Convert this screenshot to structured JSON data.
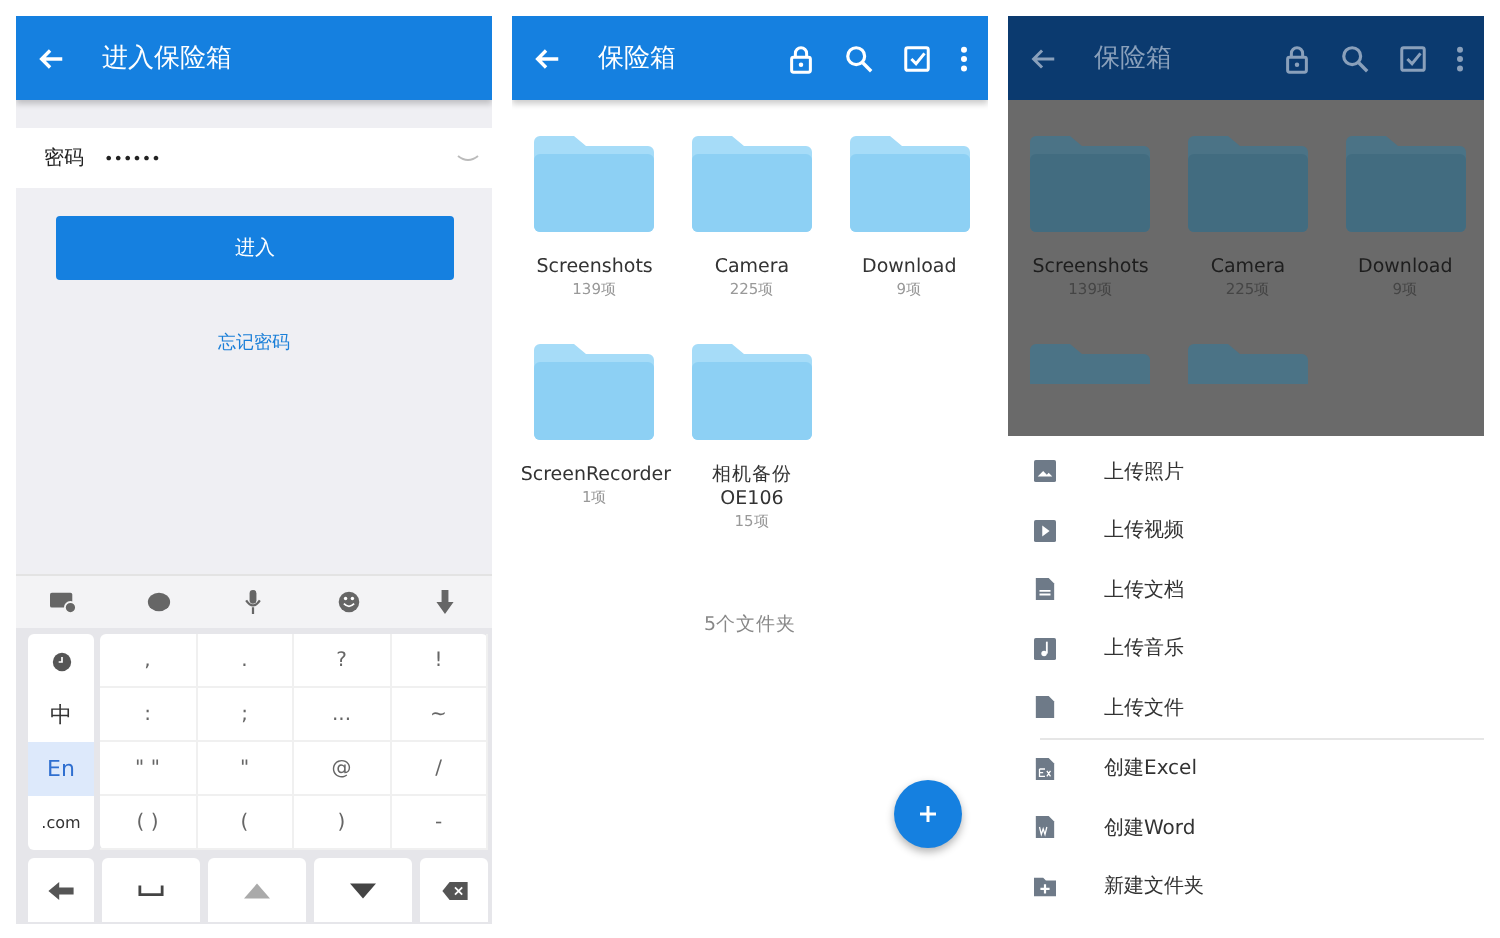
{
  "unlock_screen": {
    "title": "进入保险箱",
    "password": {
      "label": "密码",
      "value": "••••••"
    },
    "enter_button": "进入",
    "forgot_link": "忘记密码",
    "keyboard": {
      "side_keys": [
        {
          "kind": "clock",
          "selected": false
        },
        {
          "kind": "text",
          "label": "中",
          "selected": false
        },
        {
          "kind": "text",
          "label": "En",
          "selected": true
        },
        {
          "kind": "text",
          "label": ".com",
          "selected": false
        }
      ],
      "symbol_keys": [
        ",",
        ".",
        "?",
        "!",
        ":",
        ";",
        "...",
        "~",
        "\" \"",
        "\"",
        "@",
        "/",
        "( )",
        "(",
        ")",
        "-"
      ]
    }
  },
  "vault": {
    "title": "保险箱",
    "folders": [
      {
        "name": "Screenshots",
        "count": "139项"
      },
      {
        "name": "Camera",
        "count": "225项"
      },
      {
        "name": "Download",
        "count": "9项"
      },
      {
        "name": "ScreenRecorder",
        "count": "1项"
      },
      {
        "name": "相机备份 OE106",
        "count": "15项"
      }
    ],
    "summary": "5个文件夹"
  },
  "vault_with_menu": {
    "title": "保险箱",
    "folders": [
      {
        "name": "Screenshots",
        "count": "139项"
      },
      {
        "name": "Camera",
        "count": "225项"
      },
      {
        "name": "Download",
        "count": "9项"
      }
    ],
    "upload_items": [
      {
        "kind": "photo",
        "label": "上传照片"
      },
      {
        "kind": "video",
        "label": "上传视频"
      },
      {
        "kind": "document",
        "label": "上传文档"
      },
      {
        "kind": "music",
        "label": "上传音乐"
      },
      {
        "kind": "file",
        "label": "上传文件"
      }
    ],
    "create_items": [
      {
        "kind": "excel",
        "label": "创建Excel"
      },
      {
        "kind": "word",
        "label": "创建Word"
      },
      {
        "kind": "folder",
        "label": "新建文件夹"
      }
    ]
  }
}
